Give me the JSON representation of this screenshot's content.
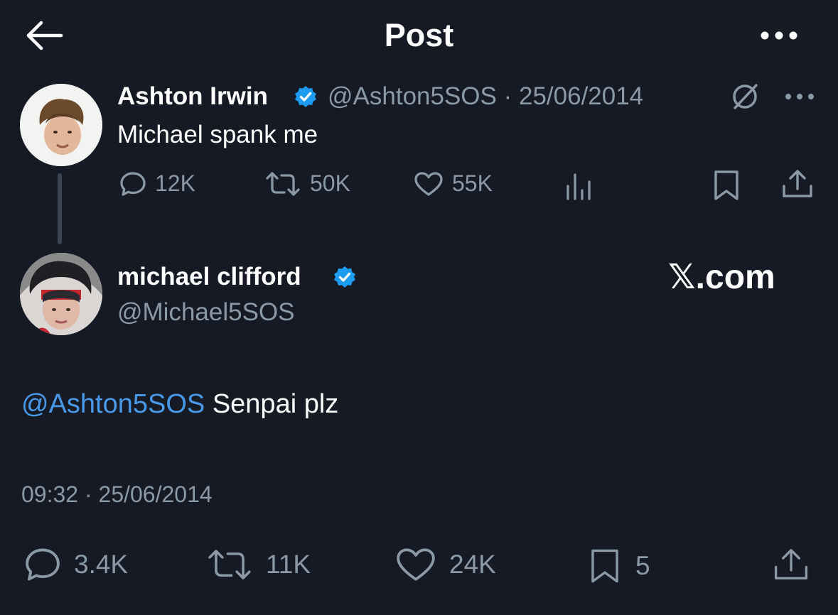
{
  "header": {
    "title": "Post",
    "back_icon": "arrow-left-icon",
    "more_icon": "more-horizontal-icon"
  },
  "colors": {
    "background": "#151a24",
    "text_primary": "#ffffff",
    "text_secondary": "#8b98a5",
    "accent_blue": "#4a99e9",
    "verified_blue": "#1d9bf0"
  },
  "parent_tweet": {
    "author_name": "Ashton Irwin",
    "handle_date": "@Ashton5SOS · 25/06/2014",
    "text": "Michael spank me",
    "metrics": {
      "replies": "12K",
      "retweets": "50K",
      "likes": "55K"
    }
  },
  "main_tweet": {
    "author_name": "michael clifford",
    "handle": "@Michael5SOS",
    "watermark": "𝕏.com",
    "mention": "@Ashton5SOS",
    "text": " Senpai plz",
    "timestamp": "09:32 · 25/06/2014",
    "metrics": {
      "replies": "3.4K",
      "retweets": "11K",
      "likes": "24K",
      "bookmarks": "5"
    }
  }
}
